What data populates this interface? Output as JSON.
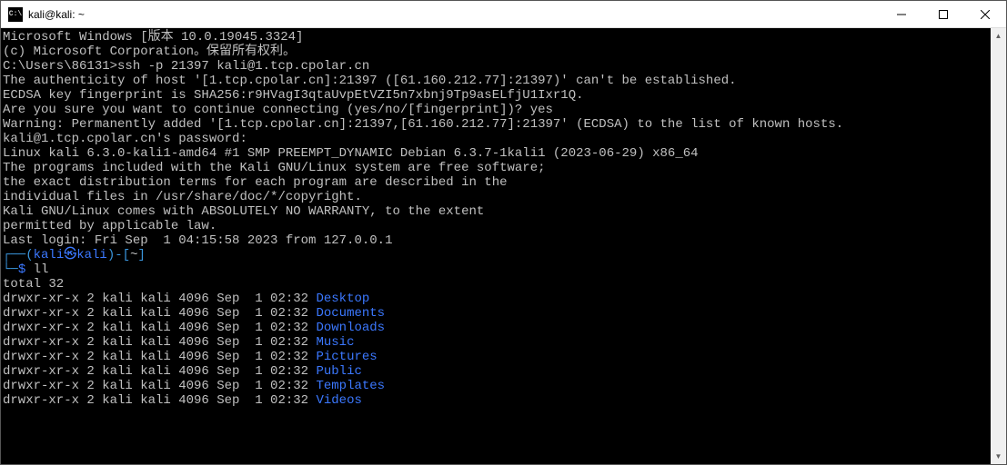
{
  "titlebar": {
    "icon_label": "cmd-icon",
    "title": "kali@kali: ~"
  },
  "lines": {
    "l1": "Microsoft Windows [版本 10.0.19045.3324]",
    "l2": "(c) Microsoft Corporation。保留所有权利。",
    "l3": "",
    "l4": "C:\\Users\\86131>ssh -p 21397 kali@1.tcp.cpolar.cn",
    "l5": "The authenticity of host '[1.tcp.cpolar.cn]:21397 ([61.160.212.77]:21397)' can't be established.",
    "l6": "ECDSA key fingerprint is SHA256:r9HVagI3qtaUvpEtVZI5n7xbnj9Tp9asELfjU1Ixr1Q.",
    "l7": "Are you sure you want to continue connecting (yes/no/[fingerprint])? yes",
    "l8": "Warning: Permanently added '[1.tcp.cpolar.cn]:21397,[61.160.212.77]:21397' (ECDSA) to the list of known hosts.",
    "l9": "kali@1.tcp.cpolar.cn's password:",
    "l10": "Linux kali 6.3.0-kali1-amd64 #1 SMP PREEMPT_DYNAMIC Debian 6.3.7-1kali1 (2023-06-29) x86_64",
    "l11": "",
    "l12": "The programs included with the Kali GNU/Linux system are free software;",
    "l13": "the exact distribution terms for each program are described in the",
    "l14": "individual files in /usr/share/doc/*/copyright.",
    "l15": "",
    "l16": "Kali GNU/Linux comes with ABSOLUTELY NO WARRANTY, to the extent",
    "l17": "permitted by applicable law.",
    "l18": "Last login: Fri Sep  1 04:15:58 2023 from 127.0.0.1"
  },
  "prompt": {
    "corner_top": "┌──",
    "paren_open": "(",
    "user": "kali㉿kali",
    "paren_close": ")",
    "dash": "-[",
    "tilde": "~",
    "close": "]",
    "corner_bottom": "└─",
    "dollar": "$",
    "cmd": " ll"
  },
  "ls": {
    "total": "total 32",
    "rows": [
      {
        "perm": "drwxr-xr-x 2 kali kali 4096 Sep  1 02:32 ",
        "name": "Desktop"
      },
      {
        "perm": "drwxr-xr-x 2 kali kali 4096 Sep  1 02:32 ",
        "name": "Documents"
      },
      {
        "perm": "drwxr-xr-x 2 kali kali 4096 Sep  1 02:32 ",
        "name": "Downloads"
      },
      {
        "perm": "drwxr-xr-x 2 kali kali 4096 Sep  1 02:32 ",
        "name": "Music"
      },
      {
        "perm": "drwxr-xr-x 2 kali kali 4096 Sep  1 02:32 ",
        "name": "Pictures"
      },
      {
        "perm": "drwxr-xr-x 2 kali kali 4096 Sep  1 02:32 ",
        "name": "Public"
      },
      {
        "perm": "drwxr-xr-x 2 kali kali 4096 Sep  1 02:32 ",
        "name": "Templates"
      },
      {
        "perm": "drwxr-xr-x 2 kali kali 4096 Sep  1 02:32 ",
        "name": "Videos"
      }
    ]
  }
}
